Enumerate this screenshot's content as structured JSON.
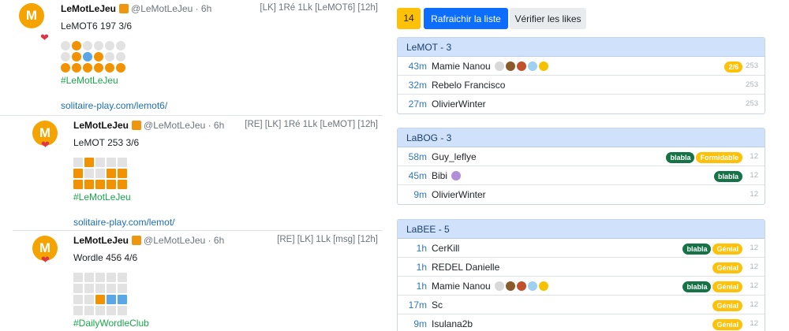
{
  "posts": [
    {
      "avatar": "M",
      "author": "LeMotLeJeu",
      "handle": "@LeMotLeJeu · 6h",
      "tags": "[LK] 1Ré 1Lk [LeMOT6] [12h]",
      "text": "LeMOT6 197 3/6",
      "grid": [
        [
          "g",
          "o",
          "g",
          "g",
          "g",
          "g"
        ],
        [
          "g",
          "o",
          "b",
          "o",
          "g",
          "g"
        ],
        [
          "o",
          "o",
          "o",
          "o",
          "o",
          "o"
        ]
      ],
      "grid_shape": "circle",
      "hashtag": "#LeMotLeJeu",
      "link": "solitaire-play.com/lemot6/"
    },
    {
      "avatar": "M",
      "author": "LeMotLeJeu",
      "handle": "@LeMotLeJeu · 6h",
      "tags": "[RE] [LK] 1Ré 1Lk [LeMOT] [12h]",
      "text": "LeMOT 253 3/6",
      "grid": [
        [
          "g",
          "o",
          "g",
          "g",
          "g"
        ],
        [
          "o",
          "g",
          "g",
          "o",
          "o"
        ],
        [
          "o",
          "o",
          "o",
          "o",
          "o"
        ]
      ],
      "grid_shape": "square",
      "hashtag": "#LeMotLeJeu",
      "link": "solitaire-play.com/lemot/"
    },
    {
      "avatar": "M",
      "author": "LeMotLeJeu",
      "handle": "@LeMotLeJeu · 6h",
      "tags": "[RE] [LK] 1Lk [msg] [12h]",
      "text": "Wordle 456 4/6",
      "grid": [
        [
          "g",
          "g",
          "g",
          "g",
          "g"
        ],
        [
          "g",
          "g",
          "g",
          "g",
          "g"
        ],
        [
          "g",
          "g",
          "o",
          "b",
          "b"
        ],
        [
          "g",
          "g",
          "g",
          "g",
          "g"
        ]
      ],
      "grid_shape": "square",
      "hashtag": "#DailyWordleClub",
      "link": ""
    }
  ],
  "toolbar": {
    "count": "14",
    "refresh_label": "Rafraichir la liste",
    "verify_label": "Vérifier les likes"
  },
  "cards": [
    {
      "title": "LeMOT - 3",
      "rows": [
        {
          "time": "43m",
          "name": "Mamie Nanou",
          "emojis": [
            "#d8d8d8",
            "#8a5a2b",
            "#c2502b",
            "#9ed0f0",
            "#f5c200"
          ],
          "pills": [
            {
              "text": "2/6",
              "color": "yellow"
            }
          ],
          "num": "253"
        },
        {
          "time": "32m",
          "name": "Rebelo Francisco",
          "emojis": [],
          "pills": [],
          "num": "253"
        },
        {
          "time": "27m",
          "name": "OlivierWinter",
          "emojis": [],
          "pills": [],
          "num": "253"
        }
      ]
    },
    {
      "title": "LaBOG - 3",
      "rows": [
        {
          "time": "58m",
          "name": "Guy_leflye",
          "emojis": [],
          "pills": [
            {
              "text": "blabla",
              "color": "green"
            },
            {
              "text": "Formidable",
              "color": "yellow"
            }
          ],
          "num": "12"
        },
        {
          "time": "45m",
          "name": "Bibi",
          "emojis": [
            "#b08fd8"
          ],
          "pills": [
            {
              "text": "blabla",
              "color": "green"
            }
          ],
          "num": "12"
        },
        {
          "time": "9m",
          "name": "OlivierWinter",
          "emojis": [],
          "pills": [],
          "num": "12"
        }
      ]
    },
    {
      "title": "LaBEE - 5",
      "rows": [
        {
          "time": "1h",
          "name": "CerKill",
          "emojis": [],
          "pills": [
            {
              "text": "blabla",
              "color": "green"
            },
            {
              "text": "Génial",
              "color": "yellow"
            }
          ],
          "num": "12"
        },
        {
          "time": "1h",
          "name": "REDEL Danielle",
          "emojis": [],
          "pills": [
            {
              "text": "Génial",
              "color": "yellow"
            }
          ],
          "num": "12"
        },
        {
          "time": "1h",
          "name": "Mamie Nanou",
          "emojis": [
            "#d8d8d8",
            "#8a5a2b",
            "#c2502b",
            "#9ed0f0",
            "#f5c200"
          ],
          "pills": [
            {
              "text": "blabla",
              "color": "green"
            },
            {
              "text": "Génial",
              "color": "yellow"
            }
          ],
          "num": "12"
        },
        {
          "time": "17m",
          "name": "Sc",
          "emojis": [],
          "pills": [
            {
              "text": "Génial",
              "color": "yellow"
            }
          ],
          "num": "12"
        },
        {
          "time": "9m",
          "name": "Isulana2b",
          "emojis": [],
          "pills": [
            {
              "text": "Génial",
              "color": "yellow"
            }
          ],
          "num": "12"
        }
      ]
    }
  ]
}
